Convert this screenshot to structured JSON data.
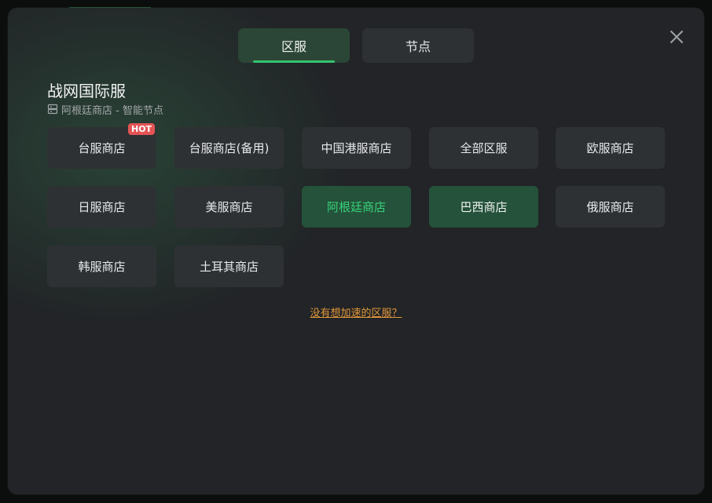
{
  "colors": {
    "accent_green": "#33c46f",
    "selected_text": "#37d37a",
    "selected_bg": "#24523a",
    "hot_badge": "#e35455",
    "link_orange": "#e0963a"
  },
  "tabs": [
    {
      "label": "区服",
      "active": true
    },
    {
      "label": "节点",
      "active": false
    }
  ],
  "close_icon": "close-icon",
  "section": {
    "title": "战网国际服",
    "subtitle_icon": "server-icon",
    "subtitle": "阿根廷商店 - 智能节点"
  },
  "regions": [
    {
      "label": "台服商店",
      "badge": "HOT",
      "state": "normal"
    },
    {
      "label": "台服商店(备用)",
      "state": "normal"
    },
    {
      "label": "中国港服商店",
      "state": "normal"
    },
    {
      "label": "全部区服",
      "state": "normal"
    },
    {
      "label": "欧服商店",
      "state": "normal"
    },
    {
      "label": "日服商店",
      "state": "normal"
    },
    {
      "label": "美服商店",
      "state": "normal"
    },
    {
      "label": "阿根廷商店",
      "state": "selected"
    },
    {
      "label": "巴西商店",
      "state": "hover"
    },
    {
      "label": "俄服商店",
      "state": "normal"
    },
    {
      "label": "韩服商店",
      "state": "normal"
    },
    {
      "label": "土耳其商店",
      "state": "normal"
    }
  ],
  "footer": {
    "link": "没有想加速的区服？"
  }
}
